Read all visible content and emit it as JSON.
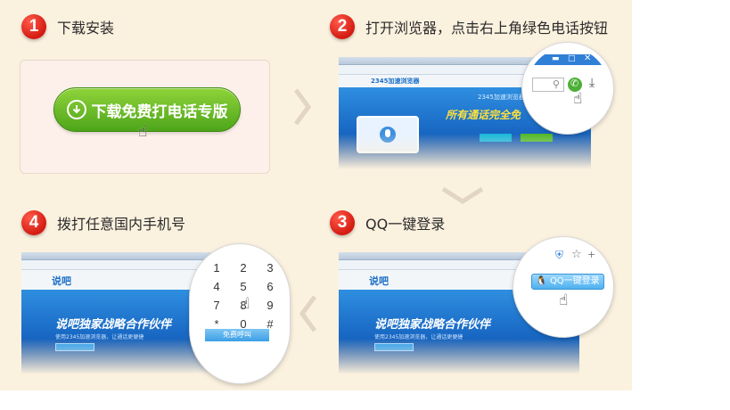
{
  "steps": [
    {
      "number": "1",
      "title": "下载安装"
    },
    {
      "number": "2",
      "title": "打开浏览器，点击右上角绿色电话按钮"
    },
    {
      "number": "3",
      "title": "QQ一键登录"
    },
    {
      "number": "4",
      "title": "拨打任意国内手机号"
    }
  ],
  "download_button": {
    "label": "下载免费打电话专版"
  },
  "screenshot2": {
    "brand": "2345加速浏览器",
    "slogan": "所有通话完全免",
    "sub": "2345加速浏览器 免"
  },
  "screenshot_shuoba": {
    "brand": "说吧",
    "headline": "说吧独家战略合作伙伴",
    "sub": "使用2345加速浏览器，让通话更便捷"
  },
  "keypad": {
    "keys": [
      "1",
      "2",
      "3",
      "4",
      "5",
      "6",
      "7",
      "8",
      "9",
      "*",
      "0",
      "#"
    ],
    "call_label": "免费呼叫"
  },
  "qq_login": {
    "label": "QQ一键登录"
  },
  "colors": {
    "background": "#fbf1df",
    "badge": "#d41b12",
    "download_button": "#5cb324",
    "hero_blue": "#1867c3"
  }
}
